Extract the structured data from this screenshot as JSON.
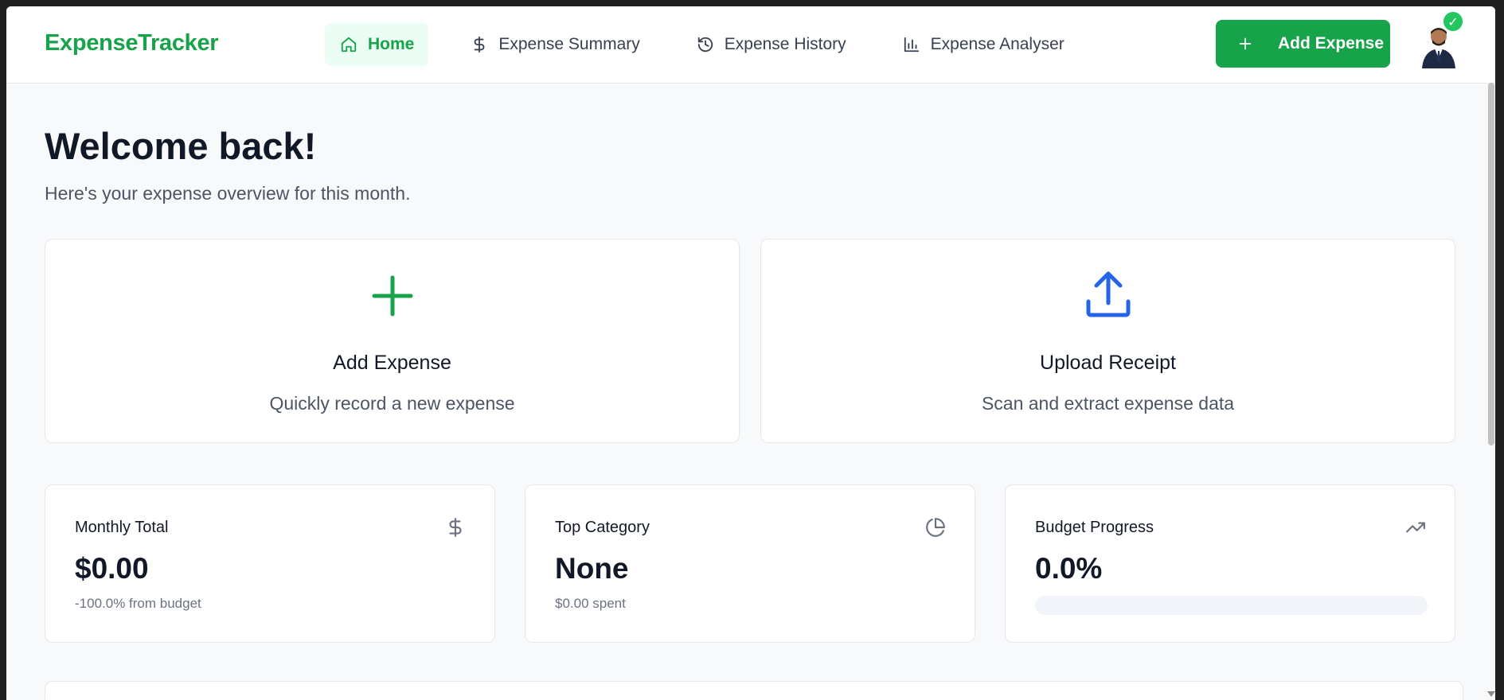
{
  "app": {
    "brand": "ExpenseTracker"
  },
  "nav": {
    "items": [
      {
        "label": "Home",
        "icon": "home-icon",
        "active": true
      },
      {
        "label": "Expense Summary",
        "icon": "dollar-icon",
        "active": false
      },
      {
        "label": "Expense History",
        "icon": "history-icon",
        "active": false
      },
      {
        "label": "Expense Analyser",
        "icon": "bar-chart-icon",
        "active": false
      }
    ]
  },
  "header": {
    "add_button_label": "Add Expense",
    "add_button_icon": "plus-icon",
    "avatar_badge": "✓"
  },
  "main": {
    "title": "Welcome back!",
    "subtitle": "Here's your expense overview for this month."
  },
  "actions": [
    {
      "title": "Add Expense",
      "description": "Quickly record a new expense",
      "icon": "plus-icon",
      "color": "#16a34a"
    },
    {
      "title": "Upload Receipt",
      "description": "Scan and extract expense data",
      "icon": "upload-icon",
      "color": "#2563eb"
    }
  ],
  "stats": {
    "monthly_total": {
      "label": "Monthly Total",
      "value": "$0.00",
      "sub": "-100.0% from budget",
      "icon": "dollar-icon"
    },
    "top_category": {
      "label": "Top Category",
      "value": "None",
      "sub": "$0.00 spent",
      "icon": "pie-chart-icon"
    },
    "budget_progress": {
      "label": "Budget Progress",
      "value": "0.0%",
      "progress": 0,
      "icon": "trending-up-icon"
    }
  },
  "colors": {
    "brand": "#16a34a",
    "accent_blue": "#2563eb",
    "active_nav_bg": "#ecfdf3"
  }
}
